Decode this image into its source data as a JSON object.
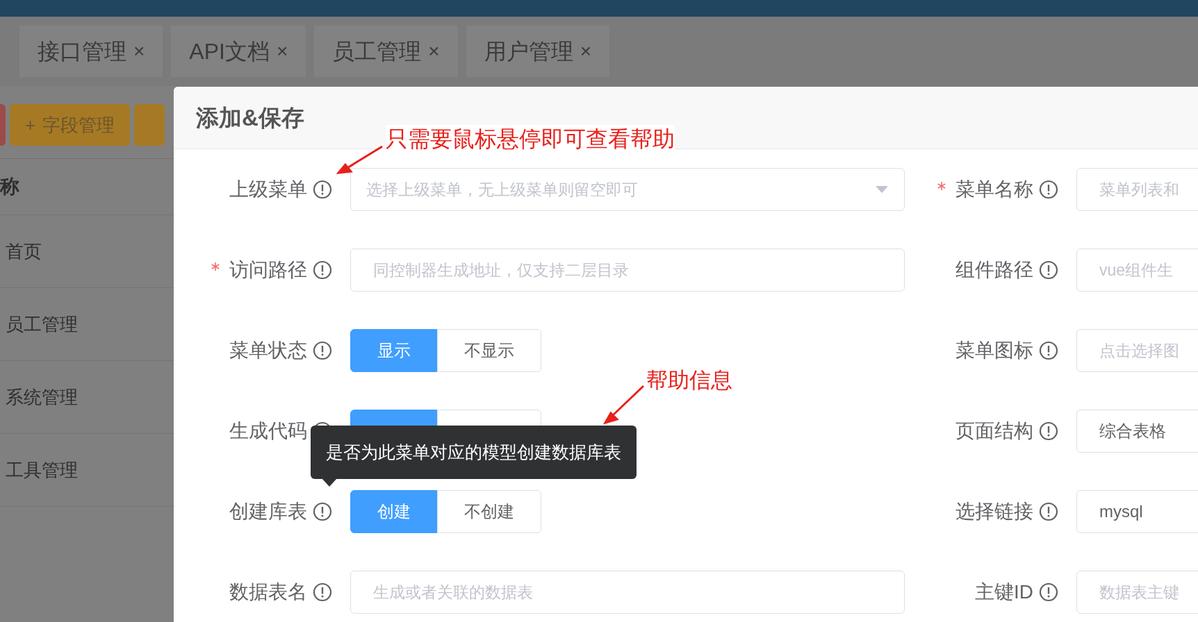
{
  "tabs": [
    {
      "label": "接口管理",
      "close": "×"
    },
    {
      "label": "API文档",
      "close": "×"
    },
    {
      "label": "员工管理",
      "close": "×"
    },
    {
      "label": "用户管理",
      "close": "×"
    }
  ],
  "toolbar_buttons": [
    {
      "kind": "danger"
    },
    {
      "kind": "warning",
      "icon": "+",
      "label": "字段管理"
    },
    {
      "kind": "warning"
    }
  ],
  "table": {
    "header": "称",
    "rows": [
      "首页",
      "员工管理",
      "系统管理",
      "工具管理"
    ]
  },
  "dialog": {
    "title": "添加&保存",
    "rows": [
      {
        "left": {
          "label": "上级菜单",
          "required": false,
          "kind": "select",
          "placeholder": "选择上级菜单，无上级菜单则留空即可"
        },
        "right": {
          "label": "菜单名称",
          "required": true,
          "kind": "input",
          "placeholder": "菜单列表和"
        }
      },
      {
        "left": {
          "label": "访问路径",
          "required": true,
          "kind": "input",
          "placeholder": "同控制器生成地址，仅支持二层目录"
        },
        "right": {
          "label": "组件路径",
          "required": false,
          "kind": "input",
          "placeholder": "vue组件生"
        }
      },
      {
        "left": {
          "label": "菜单状态",
          "required": false,
          "kind": "segmented",
          "options": [
            {
              "label": "显示",
              "selected": true
            },
            {
              "label": "不显示",
              "selected": false
            }
          ]
        },
        "right": {
          "label": "菜单图标",
          "required": false,
          "kind": "input",
          "placeholder": "点击选择图"
        }
      },
      {
        "left": {
          "label": "生成代码",
          "required": false,
          "kind": "segmented",
          "options": [
            {
              "selected": true
            },
            {
              "selected": false
            }
          ]
        },
        "right": {
          "label": "页面结构",
          "required": false,
          "kind": "input",
          "value": "综合表格"
        }
      },
      {
        "left": {
          "label": "创建库表",
          "required": false,
          "kind": "segmented",
          "options": [
            {
              "label": "创建",
              "selected": true
            },
            {
              "label": "不创建",
              "selected": false
            }
          ]
        },
        "right": {
          "label": "选择链接",
          "required": false,
          "kind": "input",
          "value": "mysql"
        }
      },
      {
        "left": {
          "label": "数据表名",
          "required": false,
          "kind": "input",
          "placeholder": "生成或者关联的数据表"
        },
        "right": {
          "label": "主键ID",
          "required": false,
          "kind": "input",
          "placeholder": "数据表主键"
        }
      }
    ]
  },
  "tooltip": {
    "text": "是否为此菜单对应的模型创建数据库表"
  },
  "annotations": [
    {
      "text": "只需要鼠标悬停即可查看帮助"
    },
    {
      "text": "帮助信息"
    }
  ]
}
